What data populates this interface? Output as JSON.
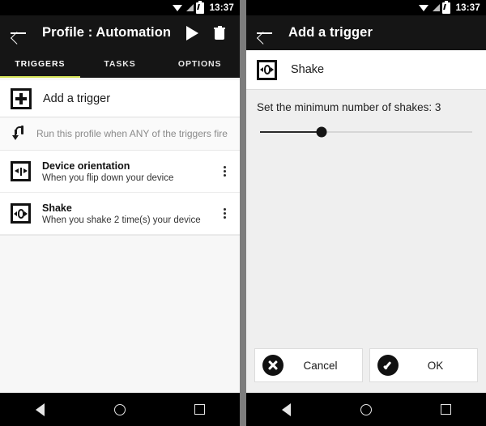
{
  "theme": {
    "accent": "#d4e157",
    "appbar_bg": "#151515",
    "content_bg": "#f7f7f7",
    "panel_bg": "#efefef",
    "card_bg": "#ffffff"
  },
  "status_bar": {
    "time": "13:37",
    "icons": [
      "wifi-icon",
      "signal-icon",
      "battery-charging-icon"
    ]
  },
  "nav_bar": {
    "back": "back-nav-icon",
    "home": "home-nav-icon",
    "recents": "recents-nav-icon"
  },
  "left_screen": {
    "appbar": {
      "back_icon": "back-arrow-icon",
      "title": "Profile : Automation",
      "play_icon": "play-icon",
      "delete_icon": "trash-icon"
    },
    "tabs": [
      {
        "label": "TRIGGERS",
        "active": true
      },
      {
        "label": "TASKS",
        "active": false
      },
      {
        "label": "OPTIONS",
        "active": false
      }
    ],
    "add_trigger": {
      "icon": "plus-box-icon",
      "label": "Add a trigger"
    },
    "hint": {
      "icon": "subdirectory-arrow-icon",
      "label": "Run this profile when ANY of the triggers fire"
    },
    "triggers": [
      {
        "icon": "device-orientation-icon",
        "title": "Device orientation",
        "subtitle": "When you flip down your device",
        "menu_icon": "more-vertical-icon"
      },
      {
        "icon": "shake-icon",
        "title": "Shake",
        "subtitle": "When you shake 2 time(s) your device",
        "menu_icon": "more-vertical-icon"
      }
    ]
  },
  "right_screen": {
    "appbar": {
      "back_icon": "back-arrow-icon",
      "title": "Add a trigger"
    },
    "selected": {
      "icon": "shake-icon",
      "label": "Shake"
    },
    "setting": {
      "label": "Set the minimum number of shakes: 3",
      "value": 3,
      "slider_percent": 29
    },
    "buttons": {
      "cancel": {
        "icon": "cancel-circle-icon",
        "label": "Cancel"
      },
      "ok": {
        "icon": "check-circle-icon",
        "label": "OK"
      }
    }
  }
}
